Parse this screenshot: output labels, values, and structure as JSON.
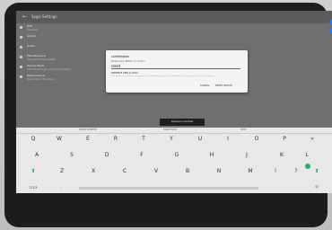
{
  "app": {
    "window_title": "Sygic Settings"
  },
  "list_items": [
    {
      "title": "WiFi",
      "subtitle": "Connected"
    },
    {
      "title": "Global",
      "subtitle": ""
    },
    {
      "title": "Audio",
      "subtitle": ""
    },
    {
      "title": "Miscellaneous",
      "subtitle": "Debug, Export log, Updates"
    },
    {
      "title": "Device Mode",
      "subtitle": "Switch to landscape or portrait orientation"
    },
    {
      "title": "Reset Device",
      "subtitle": "Delete data on this device"
    }
  ],
  "dialog": {
    "title": "confirmation",
    "field_label": "Please type \"RESET\" to confirm",
    "input_value": "reset",
    "note_title": "PRESERVE APPS & DATA?",
    "note_text": "This option lets you keep the apps and the personal data you have saved on the device after the reset is complete.",
    "cancel_label": "CANCEL",
    "confirm_label": "RESET DEVICE"
  },
  "toast": "Device is unlocked",
  "keyboard": {
    "suggestions": [
      "RESETTLEMENT",
      "RESETTLED",
      "REST"
    ],
    "row1": [
      "Q",
      "W",
      "E",
      "R",
      "T",
      "Y",
      "U",
      "I",
      "O",
      "P",
      "«"
    ],
    "row2": [
      "A",
      "S",
      "D",
      "F",
      "G",
      "H",
      "J",
      "K",
      "L"
    ],
    "row3": [
      "Z",
      "X",
      "C",
      "V",
      "B",
      "N",
      "M",
      "!",
      "?"
    ],
    "mode_key": "?123",
    "comma_key": ","
  },
  "colors": {
    "accent": "#2d78ff",
    "keyboard_bg": "#e8e8e8",
    "enter_green": "#20b36f"
  }
}
